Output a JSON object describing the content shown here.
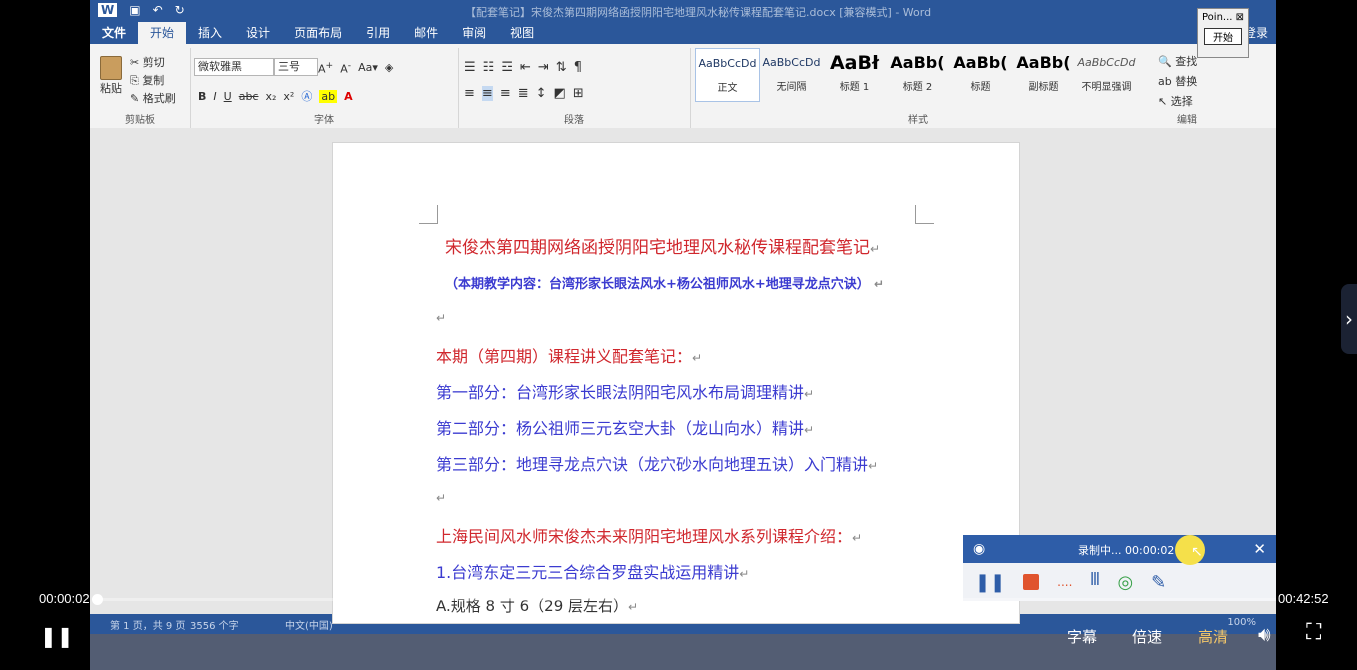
{
  "word": {
    "title": "【配套笔记】宋俊杰第四期网络函授阴阳宅地理风水秘传课程配套笔记.docx [兼容模式] - Word",
    "login": "登录",
    "tabs": [
      "文件",
      "开始",
      "插入",
      "设计",
      "页面布局",
      "引用",
      "邮件",
      "审阅",
      "视图"
    ],
    "active_tab": "开始",
    "clipboard": {
      "paste": "粘贴",
      "cut": "剪切",
      "copy": "复制",
      "format_painter": "格式刷",
      "label": "剪贴板"
    },
    "font": {
      "name": "微软雅黑",
      "size": "三号",
      "label": "字体"
    },
    "paragraph_label": "段落",
    "styles": {
      "label": "样式",
      "items": [
        {
          "sample": "AaBbCcDd",
          "name": "正文"
        },
        {
          "sample": "AaBbCcDd",
          "name": "无间隔"
        },
        {
          "sample": "AaBł",
          "name": "标题 1"
        },
        {
          "sample": "AaBb(",
          "name": "标题 2"
        },
        {
          "sample": "AaBb(",
          "name": "标题"
        },
        {
          "sample": "AaBb(",
          "name": "副标题"
        },
        {
          "sample": "AaBbCcDd",
          "name": "不明显强调"
        }
      ]
    },
    "editing": {
      "find": "查找",
      "replace": "替换",
      "select": "选择",
      "label": "编辑"
    },
    "status": {
      "page": "第 1 页，共 9 页",
      "words": "3556 个字",
      "lang": "中文(中国)",
      "zoom": "100%"
    }
  },
  "pointofix": {
    "title": "Poin...",
    "start": "开始"
  },
  "document": {
    "title": "宋俊杰第四期网络函授阴阳宅地理风水秘传课程配套笔记",
    "subtitle": "（本期教学内容：台湾形家长眼法风水+杨公祖师风水+地理寻龙点穴诀）",
    "notes_heading": "本期（第四期）课程讲义配套笔记：",
    "part1": "第一部分：台湾形家长眼法阴阳宅风水布局调理精讲",
    "part2": "第二部分：杨公祖师三元玄空大卦（龙山向水）精讲",
    "part3": "第三部分：地理寻龙点穴诀（龙穴砂水向地理五诀）入门精讲",
    "intro_heading": "上海民间风水师宋俊杰未来阴阳宅地理风水系列课程介绍：",
    "course1": "1.台湾东定三元三合综合罗盘实战运用精讲",
    "spec": "A.规格 8 寸 6（29 层左右）"
  },
  "recorder": {
    "status": "录制中... 00:00:02"
  },
  "player": {
    "current_time": "00:00:02",
    "total_time": "00:42:52",
    "subtitle_label": "字幕",
    "speed_label": "倍速",
    "quality_label": "高清",
    "progress_fraction": 0.0008
  }
}
